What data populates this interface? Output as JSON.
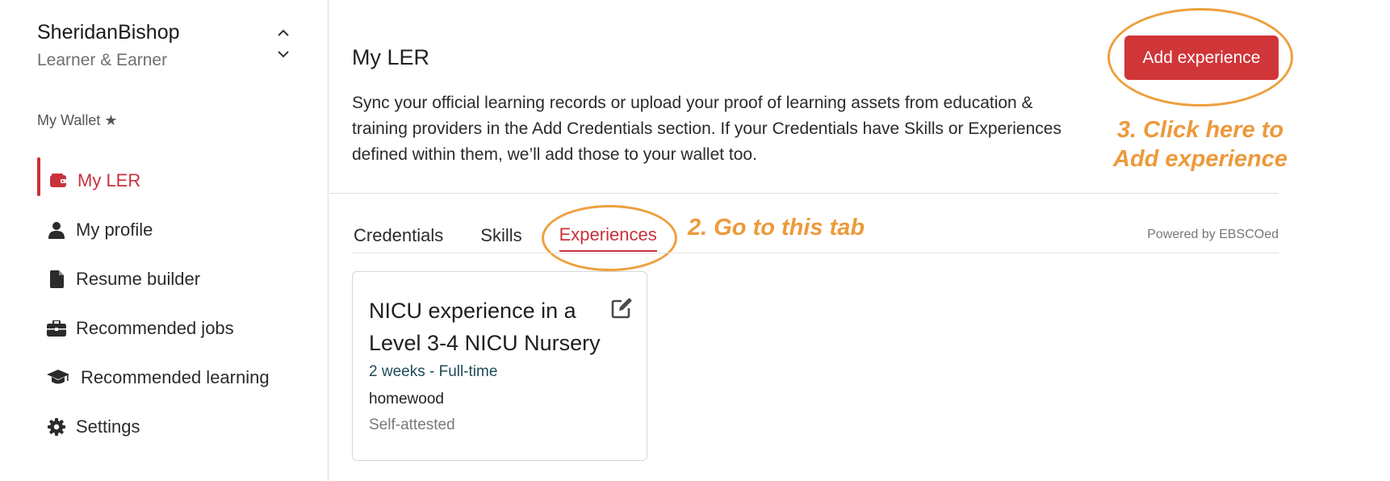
{
  "colors": {
    "accent": "#c8323a",
    "button": "#d03538",
    "annotation": "#ec9a3c",
    "duration_text": "#1f4a57"
  },
  "user": {
    "name": "SheridanBishop",
    "role": "Learner & Earner",
    "switcher_icon": "chevron-up-down-icon"
  },
  "sidebar": {
    "section_label": "My Wallet ★",
    "items": [
      {
        "label": "My LER",
        "icon": "wallet-icon",
        "active": true
      },
      {
        "label": "My profile",
        "icon": "person-icon"
      },
      {
        "label": "Resume builder",
        "icon": "document-icon"
      },
      {
        "label": "Recommended jobs",
        "icon": "briefcase-icon"
      },
      {
        "label": "Recommended learning",
        "icon": "graduation-cap-icon"
      },
      {
        "label": "Settings",
        "icon": "gear-icon"
      }
    ]
  },
  "main": {
    "title": "My LER",
    "description": "Sync your official learning records or upload your proof of learning assets from education & training providers in the Add Credentials section. If your Credentials have Skills or Experiences defined within them, we’ll add those to your wallet too.",
    "add_button": "Add experience",
    "tabs": [
      {
        "label": "Credentials"
      },
      {
        "label": "Skills"
      },
      {
        "label": "Experiences",
        "active": true
      }
    ],
    "powered_by": "Powered by EBSCOed",
    "card": {
      "title": "NICU experience in a Level 3-4 NICU Nursery",
      "duration": "2 weeks - Full-time",
      "location": "homewood",
      "status": "Self-attested",
      "edit_icon": "edit-icon"
    }
  },
  "annotations": {
    "tab_hint": "2. Go to this tab",
    "button_hint": "3. Click here to Add experience"
  }
}
